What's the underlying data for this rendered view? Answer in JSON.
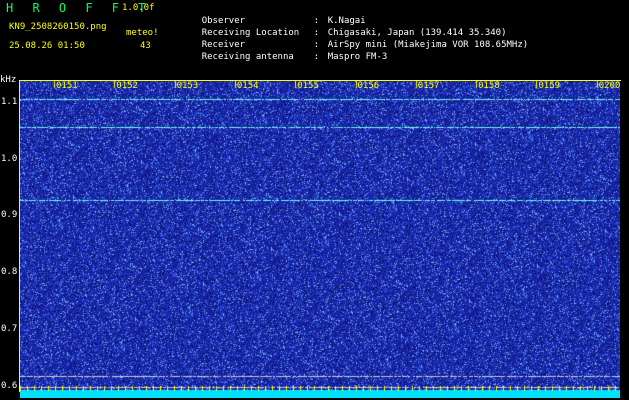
{
  "header": {
    "app_title": "H R O F F T",
    "version": "1.0.0f",
    "filename": "KN9_2508260150.png",
    "meteor_label": "meteo!",
    "datetime": "25.08.26 01:50",
    "meteor_count": "43"
  },
  "info": {
    "observer_label": "Observer",
    "observer_value": "K.Nagai",
    "location_label": "Receiving Location",
    "location_value": "Chigasaki, Japan (139.414 35.340)",
    "receiver_label": "Receiver",
    "receiver_value": "AirSpy mini (Miakejima VOR 108.65MHz)",
    "antenna_label": "Receiving antenna",
    "antenna_value": "Maspro FM-3",
    "colon": ":"
  },
  "axis": {
    "y_unit": "kHz",
    "y_labels": [
      "1.1",
      "1.0",
      "0.9",
      "0.8",
      "0.7",
      "0.6"
    ],
    "time_labels": [
      "0151",
      "0152",
      "0153",
      "0154",
      "0155",
      "0156",
      "0157",
      "0158",
      "0159",
      "0200"
    ]
  },
  "chart_data": {
    "type": "heatmap",
    "ylabel": "kHz",
    "y_ticks": [
      1.1,
      1.0,
      0.9,
      0.8,
      0.7,
      0.6
    ],
    "x_ticks": [
      "0151",
      "0152",
      "0153",
      "0154",
      "0155",
      "0156",
      "0157",
      "0158",
      "0159",
      "0200"
    ],
    "ylim": [
      0.58,
      1.14
    ],
    "colors": {
      "background": "#1a2a9a",
      "noise": "#3366ff",
      "signal": "#66ffee",
      "axis": "#ffff00"
    },
    "carrier_lines_khz": [
      1.107,
      1.057,
      0.928,
      0.618,
      0.6
    ]
  }
}
